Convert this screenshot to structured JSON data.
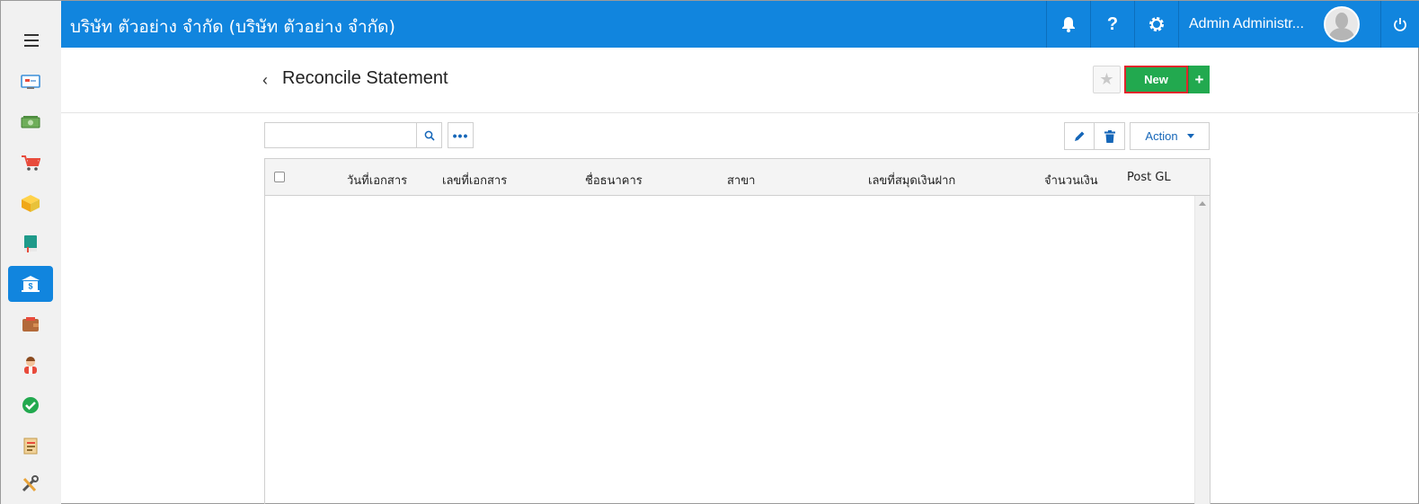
{
  "topbar": {
    "company": "บริษัท ตัวอย่าง จำกัด (บริษัท ตัวอย่าง จำกัด)",
    "help_label": "?",
    "user_name": "Admin Administr..."
  },
  "sidebar": {
    "items": [
      {
        "icon": "dashboard-icon",
        "active": false
      },
      {
        "icon": "money-icon",
        "active": false
      },
      {
        "icon": "cart-icon",
        "active": false
      },
      {
        "icon": "box-icon",
        "active": false
      },
      {
        "icon": "book-icon",
        "active": false
      },
      {
        "icon": "bank-icon",
        "active": true
      },
      {
        "icon": "wallet-icon",
        "active": false
      },
      {
        "icon": "person-icon",
        "active": false
      },
      {
        "icon": "check-icon",
        "active": false
      },
      {
        "icon": "transfer-icon",
        "active": false
      },
      {
        "icon": "tools-icon",
        "active": false
      }
    ]
  },
  "header": {
    "back_glyph": "‹",
    "title": "Reconcile Statement",
    "new_label": "New",
    "plus_label": "+"
  },
  "toolbar": {
    "search_value": "",
    "search_placeholder": "",
    "more_label": "•••",
    "action_label": "Action"
  },
  "table": {
    "columns": [
      "วันที่เอกสาร",
      "เลขที่เอกสาร",
      "ชื่อธนาคาร",
      "สาขา",
      "เลขที่สมุดเงินฝาก",
      "จำนวนเงิน",
      "Post GL"
    ],
    "rows": []
  },
  "colors": {
    "topbar": "#1185de",
    "primary_green": "#22a94f",
    "highlight_border": "#e0262b",
    "link_blue": "#1566b8"
  }
}
